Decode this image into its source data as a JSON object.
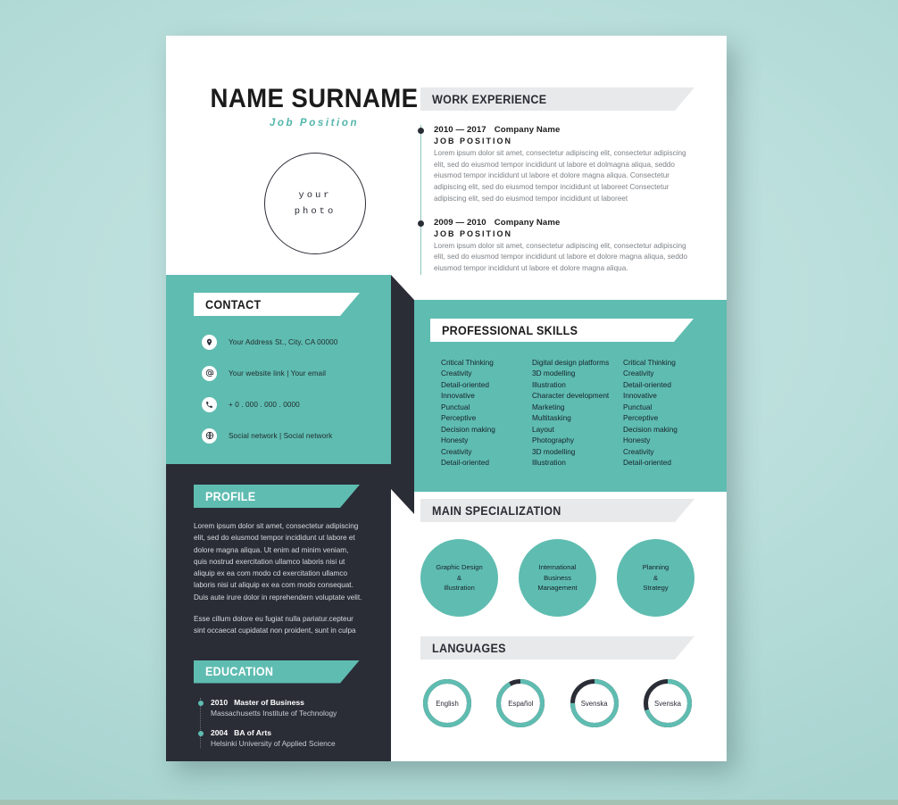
{
  "theme": {
    "teal": "#5fbcb1",
    "dark": "#2a2d36",
    "grey_ribbon": "#e8e9ea",
    "background": "#bbdfdc",
    "muted_text": "#7d8186"
  },
  "header": {
    "name": "NAME SURNAME",
    "job_position": "Job Position",
    "photo_line1": "your",
    "photo_line2": "photo"
  },
  "work_experience": {
    "ribbon_title": "WORK EXPERIENCE",
    "items": [
      {
        "years": "2010 — 2017",
        "company": "Company Name",
        "role": "JOB POSITION",
        "description": "Lorem ipsum dolor sit amet, consectetur adipiscing elit, consectetur adipiscing elit, sed do eiusmod tempor incididunt ut labore et dolmagna aliqua, seddo eiusmod tempor incididunt ut labore et dolore magna aliqua. Consectetur adipiscing elit, sed do eiusmod tempor incididunt ut laboreet Consectetur adipiscing elit, sed do eiusmod tempor incididunt ut laboreet"
      },
      {
        "years": "2009 — 2010",
        "company": "Company Name",
        "role": "JOB POSITION",
        "description": "Lorem ipsum dolor sit amet, consectetur adipiscing elit, consectetur adipiscing elit, sed do eiusmod tempor incididunt ut labore et dolore magna aliqua, seddo eiusmod tempor incididunt ut labore et dolore magna aliqua."
      }
    ]
  },
  "contact": {
    "ribbon_title": "CONTACT",
    "rows": [
      {
        "icon": "location-pin-icon",
        "text": "Your Address St., City, CA 00000"
      },
      {
        "icon": "at-sign-icon",
        "text": "Your website link  |  Your email"
      },
      {
        "icon": "phone-icon",
        "text": "+ 0 . 000 . 000 . 0000"
      },
      {
        "icon": "globe-icon",
        "text": "Social network  |  Social network"
      }
    ]
  },
  "professional_skills": {
    "ribbon_title": "PROFESSIONAL SKILLS",
    "columns": [
      [
        "Critical Thinking",
        "Creativity",
        "Detail-oriented",
        "Innovative",
        "Punctual",
        "Perceptive",
        "Decision making",
        "Honesty",
        "Creativity",
        "Detail-oriented"
      ],
      [
        "Digital design platforms",
        "3D modelling",
        "Illustration",
        "Character development",
        "Marketing",
        "Multitasking",
        "Layout",
        "Photography",
        "3D modelling",
        "Illustration"
      ],
      [
        "Critical Thinking",
        "Creativity",
        "Detail-oriented",
        "Innovative",
        "Punctual",
        "Perceptive",
        "Decision making",
        "Honesty",
        "Creativity",
        "Detail-oriented"
      ]
    ]
  },
  "profile": {
    "ribbon_title": "PROFILE",
    "paragraphs": [
      "Lorem ipsum dolor sit amet, consectetur adipiscing elit, sed do eiusmod tempor incididunt ut labore et dolore magna aliqua. Ut enim ad minim veniam, quis nostrud exercitation ullamco laboris nisi ut aliquip ex ea com modo cd exercitation ullamco laboris nisi ut aliquip ex ea com modo consequat. Duis aute irure dolor in reprehendern voluptate velit.",
      "Esse cillum dolore eu fugiat nulla pariatur.cepteur sint occaecat cupidatat non proident, sunt in culpa"
    ]
  },
  "education": {
    "ribbon_title": "EDUCATION",
    "items": [
      {
        "year": "2010",
        "degree": "Master of Business",
        "school": "Massachusetts Institute of Technology"
      },
      {
        "year": "2004",
        "degree": "BA of Arts",
        "school": "Helsinki University of Applied Science"
      }
    ]
  },
  "main_specialization": {
    "ribbon_title": "MAIN SPECIALIZATION",
    "circles": [
      {
        "lines": [
          "Graphic Design",
          "&",
          "Illustration"
        ]
      },
      {
        "lines": [
          "International",
          "Business",
          "Management"
        ]
      },
      {
        "lines": [
          "Planning",
          "&",
          "Strategy"
        ]
      }
    ]
  },
  "languages": {
    "ribbon_title": "LANGUAGES",
    "items": [
      {
        "label": "English",
        "percent": 100
      },
      {
        "label": "Español",
        "percent": 92
      },
      {
        "label": "Svenska",
        "percent": 75
      },
      {
        "label": "Svenska",
        "percent": 70
      }
    ]
  }
}
